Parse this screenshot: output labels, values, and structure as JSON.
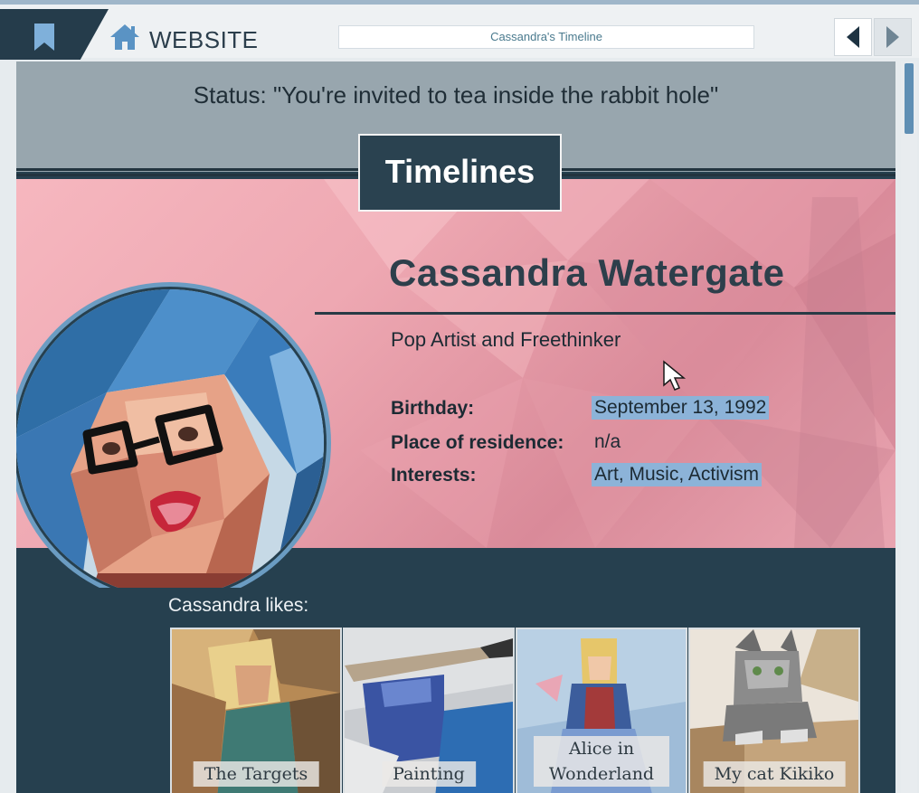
{
  "browser": {
    "site_label": "WEBSITE",
    "url_text": "Cassandra's Timeline"
  },
  "status": {
    "text": "Status: \"You're invited to tea inside the rabbit hole\""
  },
  "section_title": "Timelines",
  "profile": {
    "name": "Cassandra Watergate",
    "tagline": "Pop Artist and Freethinker",
    "birthday_label": "Birthday:",
    "birthday_value": "September 13, 1992",
    "residence_label": "Place of residence:",
    "residence_value": "n/a",
    "interests_label": "Interests:",
    "interests_value": "Art, Music, Activism"
  },
  "likes": {
    "heading": "Cassandra likes:",
    "items": [
      {
        "caption": "The Targets"
      },
      {
        "caption": "Painting"
      },
      {
        "caption": "Alice in Wonderland"
      },
      {
        "caption": "My cat Kikiko"
      }
    ]
  },
  "colors": {
    "dark_navy": "#253c4b",
    "status_band": "#98a6ae",
    "pink_band": "#eea8b2",
    "highlight": "#8cb3d8",
    "scroll_thumb": "#5f8fb4"
  },
  "icons": [
    "bookmark-icon",
    "home-icon",
    "back-arrow-icon",
    "forward-arrow-icon",
    "cursor-icon"
  ]
}
